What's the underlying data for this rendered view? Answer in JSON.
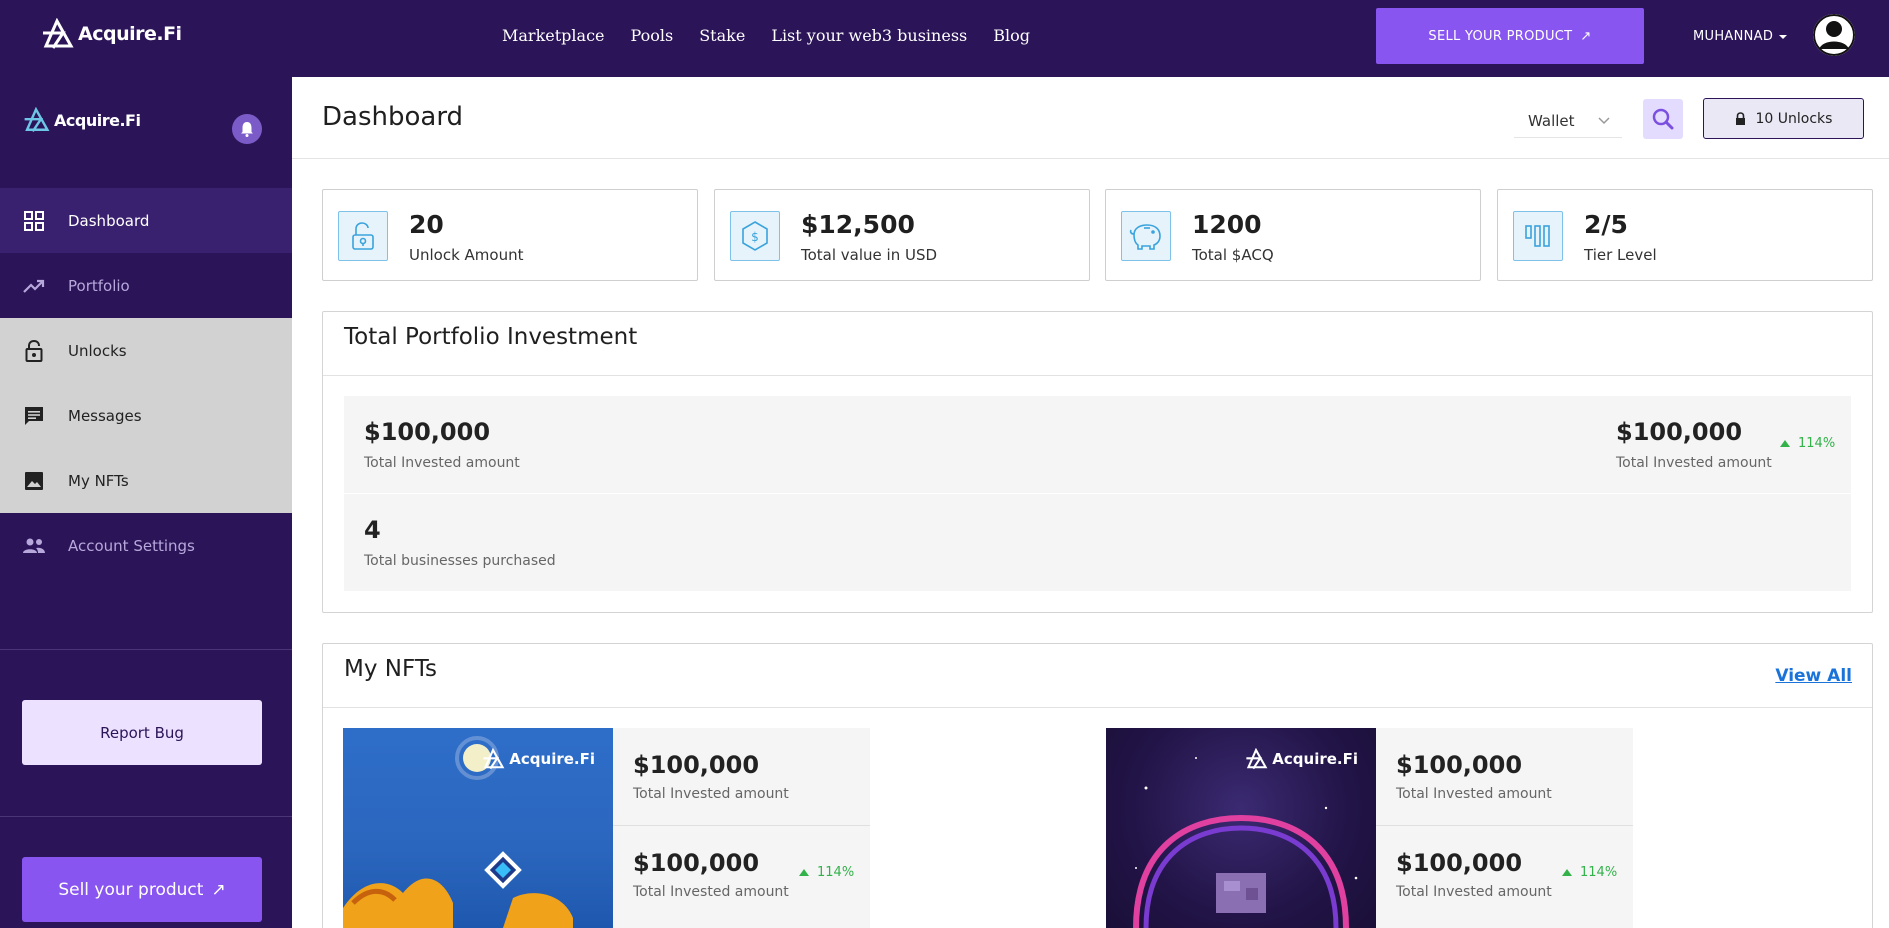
{
  "topnav": {
    "brand": "Acquire.Fi",
    "links": [
      "Marketplace",
      "Pools",
      "Stake",
      "List your web3 business",
      "Blog"
    ],
    "sell_button": "SELL YOUR PRODUCT",
    "user_name": "MUHANNAD"
  },
  "sidebar": {
    "brand": "Acquire.Fi",
    "items": [
      {
        "label": "Dashboard",
        "icon": "grid-icon"
      },
      {
        "label": "Portfolio",
        "icon": "trending-up-icon"
      },
      {
        "label": "Unlocks",
        "icon": "lock-icon"
      },
      {
        "label": "Messages",
        "icon": "message-icon"
      },
      {
        "label": "My NFTs",
        "icon": "image-icon"
      },
      {
        "label": "Account Settings",
        "icon": "people-icon"
      }
    ],
    "report_bug": "Report Bug",
    "sell_button": "Sell your product"
  },
  "header": {
    "title": "Dashboard",
    "wallet_select": "Wallet",
    "unlocks_button": "10 Unlocks"
  },
  "stats": [
    {
      "value": "20",
      "label": "Unlock Amount",
      "icon": "unlock-icon"
    },
    {
      "value": "$12,500",
      "label": "Total value in USD",
      "icon": "dollar-hex-icon"
    },
    {
      "value": "1200",
      "label": "Total $ACQ",
      "icon": "piggy-bank-icon"
    },
    {
      "value": "2/5",
      "label": "Tier Level",
      "icon": "tier-bars-icon"
    }
  ],
  "portfolio": {
    "title": "Total Portfolio Investment",
    "left_value": "$100,000",
    "left_label": "Total Invested amount",
    "right_value": "$100,000",
    "right_label": "Total Invested amount",
    "change": "114%",
    "businesses_value": "4",
    "businesses_label": "Total businesses purchased"
  },
  "nfts": {
    "title": "My NFTs",
    "view_all": "View All",
    "cards": [
      {
        "brand": "Acquire.Fi",
        "value1": "$100,000",
        "label1": "Total Invested amount",
        "value2": "$100,000",
        "label2": "Total Invested amount",
        "change": "114%"
      },
      {
        "brand": "Acquire.Fi",
        "value1": "$100,000",
        "label1": "Total Invested amount",
        "value2": "$100,000",
        "label2": "Total Invested amount",
        "change": "114%"
      }
    ]
  },
  "colors": {
    "nav_bg": "#2b1458",
    "accent": "#8855f0",
    "positive": "#33b24a",
    "link": "#1a73d9"
  }
}
